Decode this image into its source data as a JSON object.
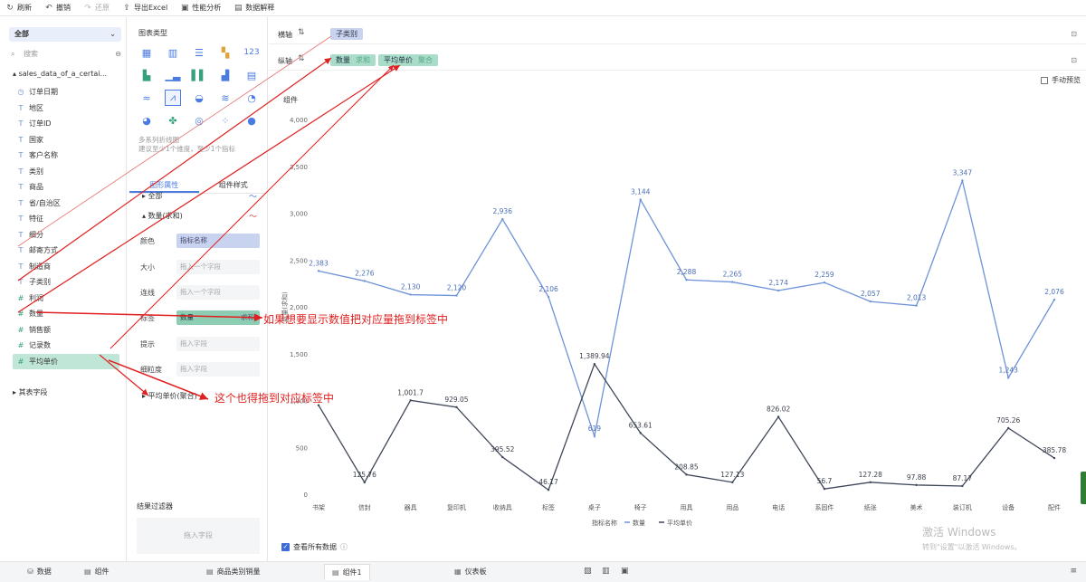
{
  "toolbar": {
    "refresh": "刷新",
    "undo": "撤销",
    "redo": "还原",
    "export_excel": "导出Excel",
    "perf_analysis": "性能分析",
    "data_explain": "数据解释"
  },
  "fields_panel": {
    "dataset_select": "全部",
    "search_placeholder": "搜索",
    "table_name": "sales_data_of_a_certai...",
    "fields": [
      {
        "type": "date",
        "label": "订单日期"
      },
      {
        "type": "text",
        "label": "地区"
      },
      {
        "type": "text",
        "label": "订单ID"
      },
      {
        "type": "text",
        "label": "国家"
      },
      {
        "type": "text",
        "label": "客户名称"
      },
      {
        "type": "text",
        "label": "类别"
      },
      {
        "type": "text",
        "label": "商品"
      },
      {
        "type": "text",
        "label": "省/自治区"
      },
      {
        "type": "text",
        "label": "特征"
      },
      {
        "type": "text",
        "label": "细分"
      },
      {
        "type": "text",
        "label": "邮寄方式"
      },
      {
        "type": "text",
        "label": "制造商"
      },
      {
        "type": "text",
        "label": "子类别"
      },
      {
        "type": "num",
        "label": "利润"
      },
      {
        "type": "num",
        "label": "数量"
      },
      {
        "type": "num",
        "label": "销售额"
      },
      {
        "type": "num",
        "label": "记录数"
      },
      {
        "type": "num",
        "label": "平均单价"
      }
    ],
    "other_group": "其表字段"
  },
  "config_panel": {
    "chart_type_title": "图表类型",
    "chart_hint_line1": "多系列折线图",
    "chart_hint_line2": "建议至少1个维度，至少1个指标",
    "tab_properties": "图形属性",
    "tab_style": "组件样式",
    "acc_all": "全部",
    "acc_quantity": "数量(求和)",
    "acc_avg_price": "平均单价(聚合)",
    "prop_color": "颜色",
    "prop_color_value": "指标名称",
    "prop_size": "大小",
    "prop_size_placeholder": "拖入一个字段",
    "prop_line": "连线",
    "prop_line_placeholder": "拖入一个字段",
    "prop_label": "标签",
    "prop_label_value": "数量",
    "prop_label_sub": "求和",
    "prop_tooltip": "提示",
    "prop_tooltip_placeholder": "拖入字段",
    "prop_detail": "细粒度",
    "prop_detail_placeholder": "拖入字段",
    "filter_title": "结果过滤器",
    "filter_placeholder": "拖入字段"
  },
  "main": {
    "x_axis_label": "横轴",
    "x_axis_pill": "子类别",
    "y_axis_label": "纵轴",
    "y_pill_1": "数量",
    "y_pill_1_sub": "求和",
    "y_pill_2": "平均单价",
    "y_pill_2_sub": "聚合",
    "manual_preview": "手动预览",
    "component_label": "组件",
    "view_all_data": "查看所有数据",
    "watermark_1": "激活 Windows",
    "watermark_2": "转到\"设置\"以激活 Windows。"
  },
  "annotations": {
    "note_1": "如果想要显示数值把对应量拖到标签中",
    "note_2": "这个也得拖到对应标签中"
  },
  "bottom_tabs": {
    "data": "数据",
    "component": "组件",
    "tab_product_sales": "商品类别销量",
    "tab_component1": "组件1",
    "tab_dashboard": "仪表板"
  },
  "colors": {
    "series_quantity": "#6f93d8",
    "series_avg_price": "#3d4658",
    "accent": "#4a7be0",
    "annotation": "#e02020"
  },
  "chart_data": {
    "type": "line",
    "categories": [
      "书架",
      "信封",
      "器具",
      "复印机",
      "收纳具",
      "标签",
      "桌子",
      "椅子",
      "用具",
      "用品",
      "电话",
      "系固件",
      "纸张",
      "美术",
      "装订机",
      "设备",
      "配件"
    ],
    "series": [
      {
        "name": "数量",
        "values": [
          2383,
          2276,
          2130,
          2120,
          2936,
          2106,
          619,
          3144,
          2288,
          2265,
          2174,
          2259,
          2057,
          2013,
          3347,
          1243,
          2076
        ],
        "labels": [
          "2,383",
          "2,276",
          "2,130",
          "2,120",
          "2,936",
          "2,106",
          "619",
          "3,144",
          "2,288",
          "2,265",
          "2,174",
          "2,259",
          "2,057",
          "2,013",
          "3,347",
          "1,243",
          "2,076"
        ]
      },
      {
        "name": "平均单价",
        "values": [
          950,
          125.76,
          1001.7,
          929.05,
          395.52,
          46.17,
          1389.94,
          653.61,
          208.85,
          127.13,
          826.02,
          56.7,
          127.28,
          97.88,
          87.17,
          705.26,
          385.78
        ],
        "labels": [
          "",
          "125.76",
          "1,001.7",
          "929.05",
          "395.52",
          "46.17",
          "1,389.94",
          "653.61",
          "208.85",
          "127.13",
          "826.02",
          "56.7",
          "127.28",
          "97.88",
          "87.17",
          "705.26",
          "385.78"
        ]
      }
    ],
    "ylabel": "数量(求和)",
    "xlabel": "指标名称",
    "legend": [
      "数量",
      "平均单价"
    ],
    "legend_prefix": "指标名称",
    "ylim": [
      0,
      4000
    ],
    "yticks": [
      "0",
      "500",
      "1,000",
      "1,500",
      "2,000",
      "2,500",
      "3,000",
      "3,500",
      "4,000"
    ],
    "ytick_values": [
      0,
      500,
      1000,
      1500,
      2000,
      2500,
      3000,
      3500,
      4000
    ],
    "grid": false,
    "legend_position": "bottom"
  }
}
